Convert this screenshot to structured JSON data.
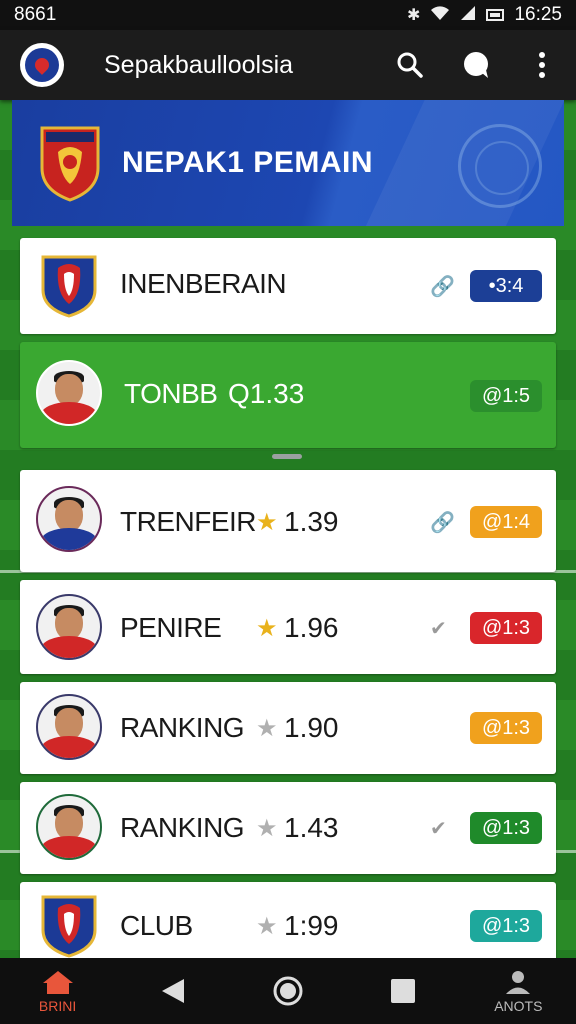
{
  "status_bar": {
    "left_text": "8661",
    "time": "16:25",
    "icons": [
      "bluetooth-icon",
      "wifi-icon",
      "signal-icon",
      "battery-icon"
    ]
  },
  "app_bar": {
    "title": "Sepakbaulloolsia",
    "actions": [
      "search-icon",
      "chat-icon",
      "more-vert-icon"
    ]
  },
  "banner": {
    "title": "NEPAK1 PEMAIN"
  },
  "rows": [
    {
      "type": "club",
      "name": "INENBERAIN",
      "value": "",
      "star": "none",
      "tag": "link-icon",
      "score": "•3:4",
      "score_color": "#1c3f96"
    },
    {
      "type": "player",
      "name": "TONBB",
      "value": "Q1.33",
      "star": "none",
      "tag": "none",
      "score": "@1:5",
      "score_color": "#2b8f2d",
      "active": true
    },
    {
      "type": "player",
      "name": "TRENFEIR",
      "value": "1.39",
      "star": "gold",
      "tag": "link-icon",
      "score": "@1:4",
      "score_color": "#f0a11d"
    },
    {
      "type": "player",
      "name": "PENIRE",
      "value": "1.96",
      "star": "gold",
      "tag": "check-icon",
      "score": "@1:3",
      "score_color": "#d9262b"
    },
    {
      "type": "player",
      "name": "RANKING",
      "value": "1.90",
      "star": "grey",
      "tag": "none",
      "score": "@1:3",
      "score_color": "#f0a11d"
    },
    {
      "type": "player",
      "name": "RANKING",
      "value": "1.43",
      "star": "grey",
      "tag": "check-icon",
      "score": "@1:3",
      "score_color": "#1f8a2a"
    },
    {
      "type": "club",
      "name": "CLUB",
      "value": "1:99",
      "star": "grey",
      "tag": "none",
      "score": "@1:3",
      "score_color": "#1ea89c"
    }
  ],
  "bottom_nav": {
    "home_label": "BRINI",
    "profile_label": "ANOTS"
  },
  "colors": {
    "app_bar": "#1c1c1c",
    "banner": "#1d47b2",
    "active_row": "#3aa831",
    "pitch": "#2a8a27",
    "home_accent": "#e8563b"
  }
}
